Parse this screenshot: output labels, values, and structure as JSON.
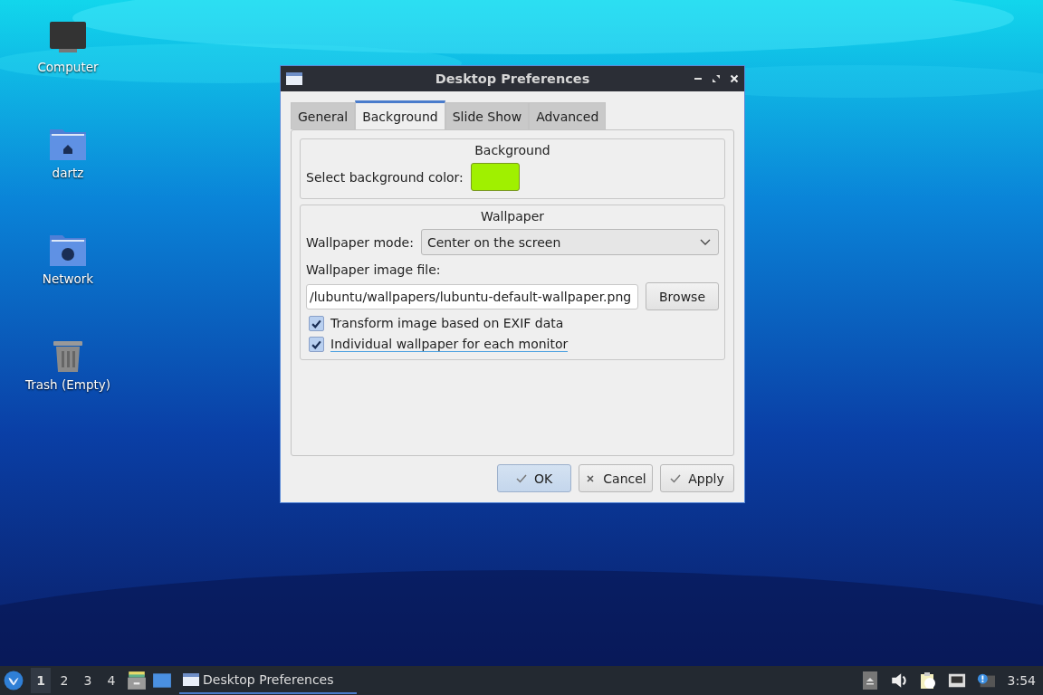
{
  "desktop_icons": [
    {
      "label": "Computer",
      "kind": "computer"
    },
    {
      "label": "dartz",
      "kind": "home"
    },
    {
      "label": "Network",
      "kind": "network"
    },
    {
      "label": "Trash (Empty)",
      "kind": "trash"
    }
  ],
  "window": {
    "title": "Desktop Preferences"
  },
  "tabs": [
    {
      "label": "General",
      "selected": false
    },
    {
      "label": "Background",
      "selected": true
    },
    {
      "label": "Slide Show",
      "selected": false
    },
    {
      "label": "Advanced",
      "selected": false
    }
  ],
  "background_group": {
    "title": "Background",
    "color_label": "Select background color:",
    "color": "#a0f000"
  },
  "wallpaper_group": {
    "title": "Wallpaper",
    "mode_label": "Wallpaper mode:",
    "mode_value": "Center on the screen",
    "file_label": "Wallpaper image file:",
    "file_value": "/lubuntu/wallpapers/lubuntu-default-wallpaper.png",
    "browse": "Browse",
    "options": [
      {
        "label": "Transform image based on EXIF data",
        "checked": true,
        "focused": false
      },
      {
        "label": "Individual wallpaper for each monitor",
        "checked": true,
        "focused": true
      }
    ]
  },
  "buttons": [
    {
      "label": "OK",
      "kind": "ok",
      "default": true
    },
    {
      "label": "Cancel",
      "kind": "cancel",
      "default": false
    },
    {
      "label": "Apply",
      "kind": "apply",
      "default": false
    }
  ],
  "taskbar": {
    "workspaces": [
      {
        "label": "1",
        "selected": true
      },
      {
        "label": "2",
        "selected": false
      },
      {
        "label": "3",
        "selected": false
      },
      {
        "label": "4",
        "selected": false
      }
    ],
    "task": "Desktop Preferences",
    "clock": "3:54"
  }
}
